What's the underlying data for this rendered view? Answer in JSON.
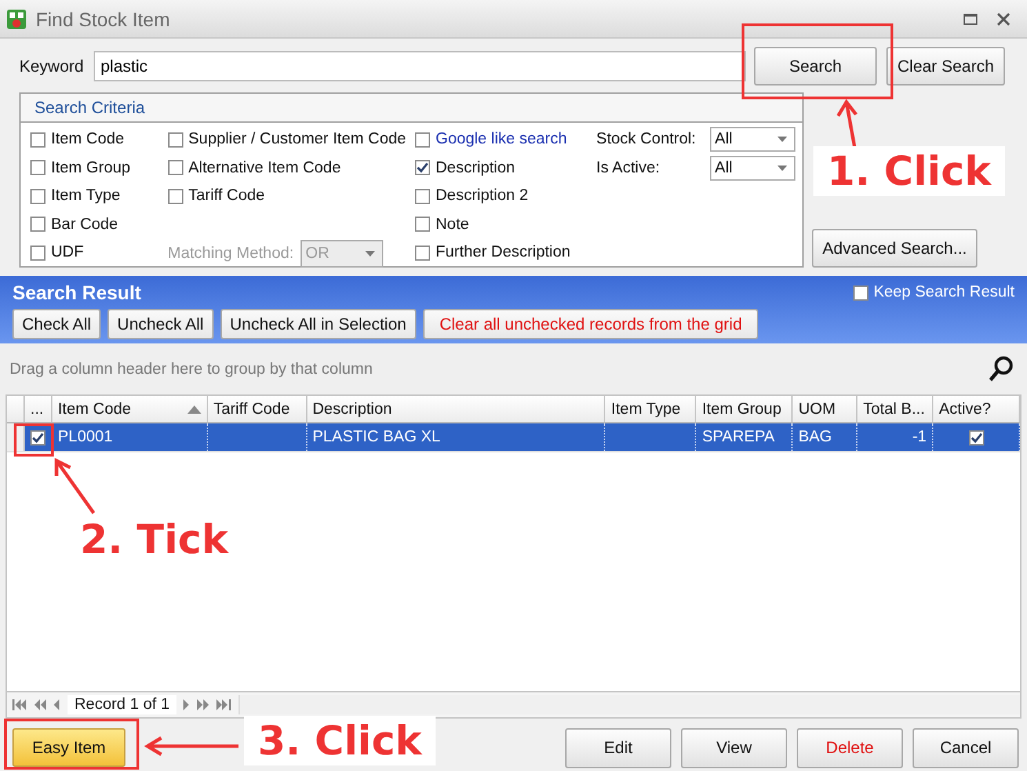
{
  "window": {
    "title": "Find Stock Item"
  },
  "keyword": {
    "label": "Keyword",
    "value": "plastic"
  },
  "top_buttons": [
    "Search",
    "Clear Search"
  ],
  "search_criteria": {
    "title": "Search Criteria",
    "columns": [
      [
        {
          "kind": "checkbox",
          "label": "Item Code",
          "checked": false
        },
        {
          "kind": "checkbox",
          "label": "Item Group",
          "checked": false
        },
        {
          "kind": "checkbox",
          "label": "Item Type",
          "checked": false
        },
        {
          "kind": "checkbox",
          "label": "Bar Code",
          "checked": false
        },
        {
          "kind": "checkbox",
          "label": "UDF",
          "checked": false
        }
      ],
      [
        {
          "kind": "checkbox",
          "label": "Supplier / Customer Item Code",
          "checked": false
        },
        {
          "kind": "checkbox",
          "label": "Alternative Item Code",
          "checked": false
        },
        {
          "kind": "checkbox",
          "label": "Tariff Code",
          "checked": false
        },
        {
          "kind": "select",
          "label": "Matching Method:",
          "value": "OR",
          "disabled": true
        }
      ],
      [
        {
          "kind": "link_checkbox",
          "label": "Google like search",
          "checked": false
        },
        {
          "kind": "checkbox",
          "label": "Description",
          "checked": true
        },
        {
          "kind": "checkbox",
          "label": "Description 2",
          "checked": false
        },
        {
          "kind": "checkbox",
          "label": "Note",
          "checked": false
        },
        {
          "kind": "checkbox",
          "label": "Further Description",
          "checked": false
        }
      ],
      [
        {
          "kind": "select",
          "label": "Stock Control:",
          "value": "All",
          "disabled": false
        },
        {
          "kind": "select",
          "label": "Is Active:",
          "value": "All",
          "disabled": false
        }
      ]
    ]
  },
  "advanced_search_button": "Advanced Search...",
  "search_result": {
    "title": "Search Result",
    "keep_search_result": {
      "label": "Keep Search Result",
      "checked": false
    },
    "buttons": [
      {
        "kind": "normal",
        "label": "Check All"
      },
      {
        "kind": "normal",
        "label": "Uncheck All"
      },
      {
        "kind": "normal",
        "label": "Uncheck All in Selection"
      },
      {
        "kind": "warning",
        "label": "Clear all unchecked records from the grid"
      }
    ]
  },
  "group_panel": {
    "hint": "Drag a column header here to group by that column"
  },
  "grid": {
    "check_column_label": "...",
    "columns": [
      {
        "label": "Item Code",
        "sorted": true
      },
      {
        "label": "Tariff Code",
        "sorted": false
      },
      {
        "label": "Description",
        "sorted": false
      },
      {
        "label": "Item Type",
        "sorted": false
      },
      {
        "label": "Item Group",
        "sorted": false
      },
      {
        "label": "UOM",
        "sorted": false
      },
      {
        "label": "Total B...",
        "sorted": false
      },
      {
        "label": "Active?",
        "sorted": false
      }
    ],
    "rows": [
      {
        "selected": true,
        "checked": true,
        "cells": [
          "PL0001",
          null,
          "PLASTIC BAG XL",
          null,
          "SPAREPA",
          "BAG",
          "-1"
        ],
        "active": true
      }
    ]
  },
  "navigator": {
    "record": "Record 1 of 1"
  },
  "footer_buttons": [
    {
      "kind": "primary",
      "label": "Easy Item"
    },
    {
      "kind": "normal",
      "label": "Edit"
    },
    {
      "kind": "normal",
      "label": "View"
    },
    {
      "kind": "danger",
      "label": "Delete"
    },
    {
      "kind": "normal",
      "label": "Cancel"
    }
  ],
  "annotations": [
    {
      "text": "1. Click"
    },
    {
      "text": "2. Tick"
    },
    {
      "text": "3. Click"
    }
  ]
}
